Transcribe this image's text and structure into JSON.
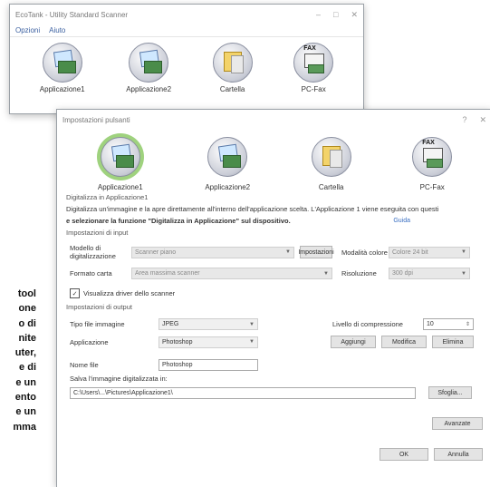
{
  "back_window": {
    "title": "EcoTank - Utility Standard Scanner",
    "menu": [
      "Opzioni",
      "Aiuto"
    ],
    "icons": [
      {
        "label": "Applicazione1",
        "icon": "scanner-to-app-icon"
      },
      {
        "label": "Applicazione2",
        "icon": "scanner-to-app-icon"
      },
      {
        "label": "Cartella",
        "icon": "scanner-to-folder-icon"
      },
      {
        "label": "PC-Fax",
        "icon": "pc-fax-icon"
      }
    ]
  },
  "dialog": {
    "title": "Impostazioni pulsanti",
    "icons": [
      {
        "label": "Applicazione1",
        "icon": "scanner-to-app-icon"
      },
      {
        "label": "Applicazione2",
        "icon": "scanner-to-app-icon"
      },
      {
        "label": "Cartella",
        "icon": "scanner-to-folder-icon"
      },
      {
        "label": "PC-Fax",
        "icon": "pc-fax-icon"
      }
    ],
    "section_title": "Digitalizza in Applicazione1",
    "description_1": "Digitalizza un'immagine e la apre direttamente all'interno dell'applicazione scelta. L'Applicazione 1 viene eseguita con questi",
    "description_2": "e selezionare la funzione \"Digitalizza in Applicazione\" sul dispositivo.",
    "guide_link": "Guida",
    "input_section": "Impostazioni di input",
    "scanner_label": "Modello di digitalizzazione",
    "scanner_value": "Scanner piano",
    "scanner_btn": "Impostazioni",
    "color_label": "Modalità colore",
    "color_value": "Colore 24 bit",
    "format_label": "Formato carta",
    "format_value": "Area massima scanner",
    "res_label": "Risoluzione",
    "res_value": "300 dpi",
    "checkbox_label": "Visualizza driver dello scanner",
    "output_section": "Impostazioni di output",
    "filetype_label": "Tipo file immagine",
    "filetype_value": "JPEG",
    "compress_label": "Livello di compressione",
    "compress_value": "10",
    "app_label": "Applicazione",
    "app_value": "Photoshop",
    "add_btn": "Aggiungi",
    "edit_btn": "Modifica",
    "delete_btn": "Elimina",
    "filename_label": "Nome file",
    "filename_value": "Photoshop",
    "save_label": "Salva l'immagine digitalizzata in:",
    "save_path": "C:\\Users\\...\\Pictures\\Applicazione1\\",
    "browse_btn": "Sfoglia...",
    "advanced_btn": "Avanzate",
    "ok_btn": "OK",
    "cancel_btn": "Annulla"
  },
  "side_text": [
    "tool",
    "one",
    "o di",
    "nite",
    "uter,",
    "e di",
    "e un",
    "ento",
    "e un",
    "mma"
  ]
}
